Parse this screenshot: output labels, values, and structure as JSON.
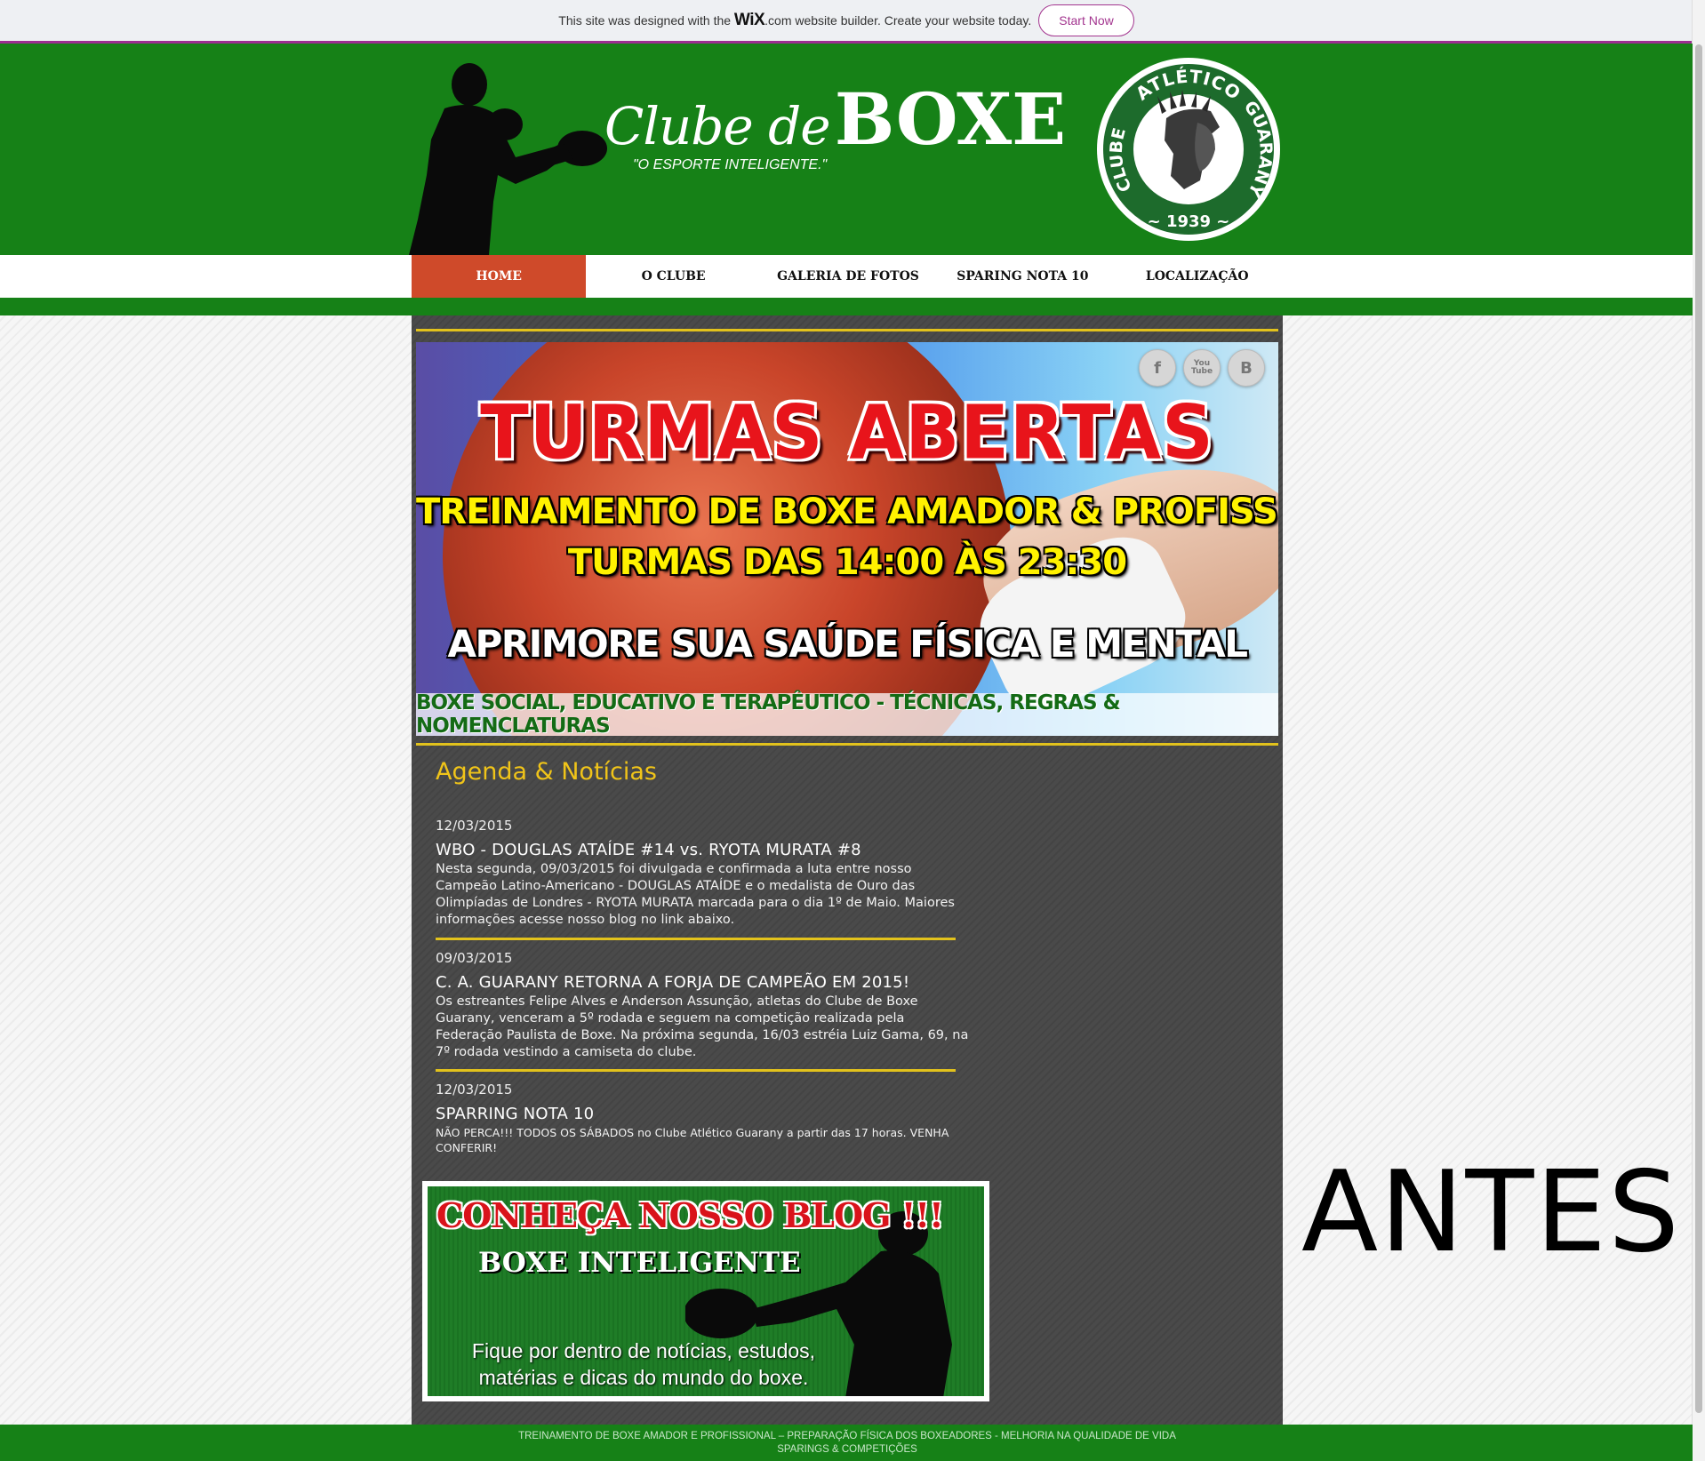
{
  "wix_banner": {
    "message_prefix": "This site was designed with the ",
    "brand": "WiX",
    "message_suffix": ".com website builder. Create your website today.",
    "cta": "Start Now"
  },
  "header": {
    "title_script": "Clube de",
    "title_bold": "BOXE",
    "tagline": "\"O ESPORTE INTELIGENTE.\"",
    "crest": {
      "arc_left": "CLUBE",
      "arc_top": "ATLÉTICO",
      "arc_right": "GUARANY",
      "year": "1939"
    }
  },
  "nav": {
    "items": [
      {
        "label": "HOME",
        "active": true
      },
      {
        "label": "O CLUBE",
        "active": false
      },
      {
        "label": "GALERIA DE FOTOS",
        "active": false
      },
      {
        "label": "SPARING NOTA 10",
        "active": false
      },
      {
        "label": "LOCALIZAÇÃO",
        "active": false
      }
    ]
  },
  "hero": {
    "title": "TURMAS ABERTAS",
    "line1": "TREINAMENTO DE BOXE AMADOR & PROFISSIONAL",
    "line2": "TURMAS DAS 14:00 ÀS 23:30",
    "line3": "APRIMORE SUA SAÚDE FÍSICA E MENTAL",
    "bottom": "BOXE SOCIAL, EDUCATIVO  E TERAPÊUTICO - TÉCNICAS, REGRAS & NOMENCLATURAS",
    "social": [
      {
        "icon": "facebook-icon",
        "glyph": "f"
      },
      {
        "icon": "youtube-icon",
        "glyph": "You\nTube"
      },
      {
        "icon": "blogger-icon",
        "glyph": "B"
      }
    ]
  },
  "news": {
    "title": "Agenda & Notícias",
    "items": [
      {
        "date": "12/03/2015",
        "headline": "WBO - DOUGLAS ATAÍDE #14 vs. RYOTA MURATA #8",
        "body": "Nesta segunda, 09/03/2015 foi divulgada e confirmada a luta entre nosso Campeão Latino-Americano - DOUGLAS ATAÍDE e o medalista de Ouro das Olimpíadas de Londres - RYOTA MURATA marcada para o dia 1º de Maio. Maiores informações acesse nosso blog no link abaixo."
      },
      {
        "date": "09/03/2015",
        "headline": "C. A. GUARANY RETORNA A FORJA DE CAMPEÃO EM 2015!",
        "body": "Os estreantes Felipe Alves e Anderson Assunção, atletas do Clube de Boxe Guarany, venceram a 5º rodada e seguem na competição realizada pela Federação Paulista de Boxe. Na próxima segunda, 16/03 estréia Luiz Gama, 69, na 7º rodada vestindo a camiseta do clube."
      },
      {
        "date": "12/03/2015",
        "headline": "SPARRING NOTA 10",
        "body": "NÃO PERCA!!! TODOS OS SÁBADOS no Clube Atlético Guarany a partir das 17 horas. VENHA CONFERIR!"
      }
    ]
  },
  "blog": {
    "title1": "CONHEÇA NOSSO BLOG !!!",
    "title2": "BOXE INTELIGENTE",
    "text": "Fique por dentro de notícias, estudos, matérias e dicas do mundo do boxe."
  },
  "footer": {
    "line1": "TREINAMENTO DE BOXE AMADOR E PROFISSIONAL – PREPARAÇÃO FÍSICA DOS BOXEADORES - MELHORIA NA QUALIDADE DE VIDA",
    "line2": "SPARINGS & COMPETIÇÕES"
  },
  "annotation": "ANTES",
  "colors": {
    "header_green": "#168117",
    "nav_active": "#cf4a2a",
    "accent_yellow": "#e2c21c",
    "panel_dark": "#4a4a4a",
    "wix_purple": "#a3358f"
  }
}
